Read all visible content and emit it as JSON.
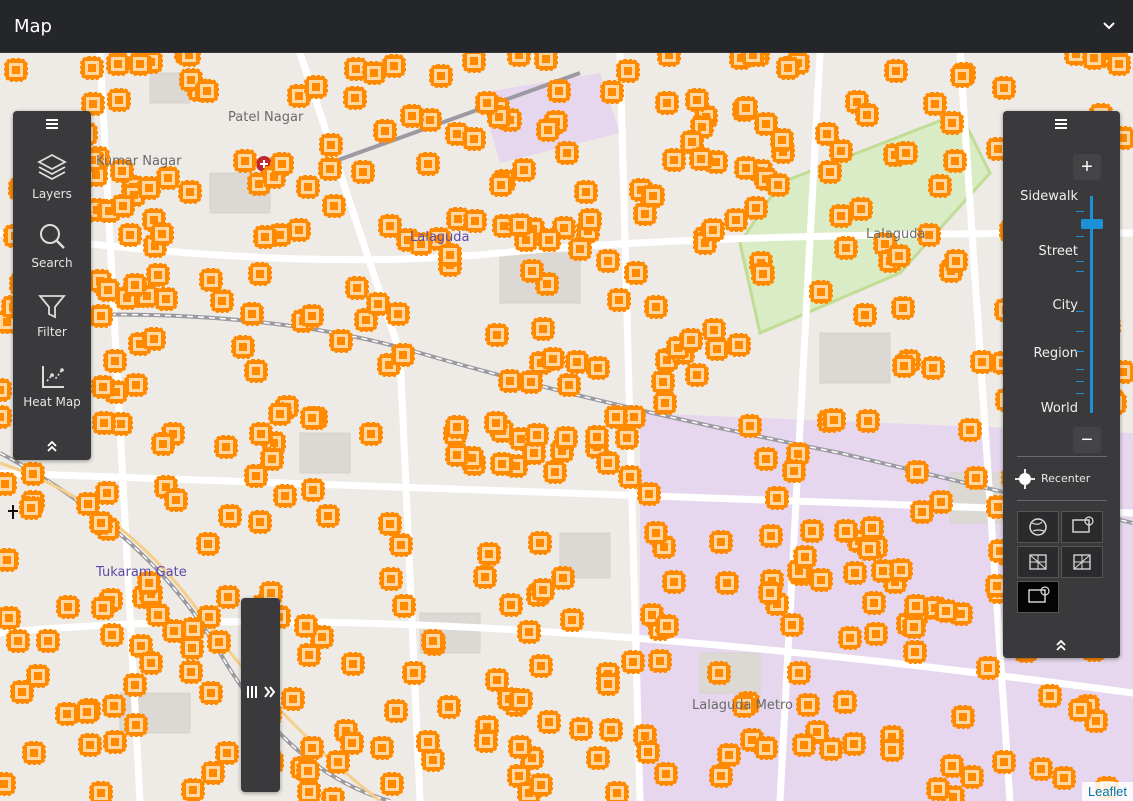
{
  "header": {
    "title": "Map"
  },
  "map": {
    "labels": [
      "Patel Nagar",
      "Kumar Nagar",
      "Lalaguda",
      "Lalaguda",
      "Lalaguda Metro",
      "Tukaram Gate"
    ],
    "attribution": "Leaflet",
    "marker_color": "#ff8a00"
  },
  "left_panel": {
    "tools": [
      {
        "label": "Layers",
        "icon": "layers-icon"
      },
      {
        "label": "Search",
        "icon": "search-icon"
      },
      {
        "label": "Filter",
        "icon": "filter-icon"
      },
      {
        "label": "Heat Map",
        "icon": "heat-map-icon"
      }
    ]
  },
  "right_panel": {
    "zoom_levels": [
      "Sidewalk",
      "Street",
      "City",
      "Region",
      "World"
    ],
    "zoom_level_value": "Sidewalk",
    "recenter_label": "Recenter",
    "basemap_options": [
      "globe",
      "satellite",
      "grid",
      "grid",
      "satellite"
    ],
    "selected_basemap_index": 4
  },
  "colors": {
    "panel": "#3a3a3d",
    "accent": "#1e90d6",
    "marker": "#ff8a00"
  }
}
